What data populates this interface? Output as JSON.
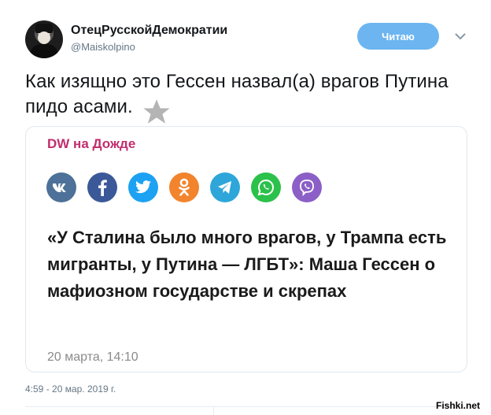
{
  "tweet": {
    "author": {
      "display_name": "ОтецРусскойДемократии",
      "handle": "@Maiskolpino"
    },
    "follow_label": "Читаю",
    "text": "Как изящно это Гессен назвал(а) врагов Путина пидо    асами.",
    "timestamp": "4:59 - 20 мар. 2019 г."
  },
  "card": {
    "source": "DW на Дожде",
    "share_icons": [
      "vk-icon",
      "facebook-icon",
      "twitter-icon",
      "odnoklassniki-icon",
      "telegram-icon",
      "whatsapp-icon",
      "viber-icon"
    ],
    "share_colors": [
      "#4d7198",
      "#3b5998",
      "#1da1f2",
      "#f2842d",
      "#2ea6d9",
      "#2bc14b",
      "#8c5fc7"
    ],
    "title": "«У Сталина было много врагов, у Трампа есть мигранты, у Путина — ЛГБТ»: Маша Гессен о мафиозном государстве и скрепах",
    "date": "20 марта, 14:10"
  },
  "watermark": "Fishki.net",
  "colors": {
    "follow_button": "#6cb5f0",
    "source_accent": "#c22d6f",
    "secondary_text": "#657786"
  }
}
